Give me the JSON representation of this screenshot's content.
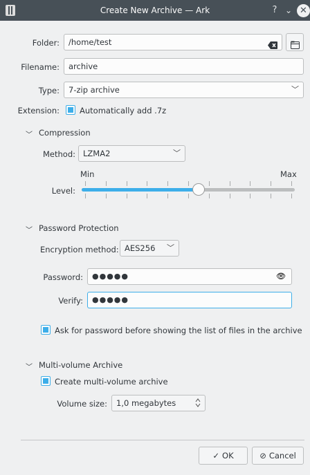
{
  "window": {
    "title": "Create New Archive — Ark",
    "help_glyph": "?",
    "minimize_glyph": "⌄",
    "close_glyph": "✕"
  },
  "folder": {
    "label": "Folder:",
    "value": "/home/test",
    "clear_icon": "backspace-clear-icon",
    "browse_icon": "folder-open-icon"
  },
  "filename": {
    "label": "Filename:",
    "value": "archive"
  },
  "type": {
    "label": "Type:",
    "selected": "7-zip archive"
  },
  "extension": {
    "label": "Extension:",
    "checkbox_label": "Automatically add .7z",
    "checked": true
  },
  "compression": {
    "section_label": "Compression",
    "method_label": "Method:",
    "method_selected": "LZMA2",
    "level_label": "Level:",
    "min_label": "Min",
    "max_label": "Max",
    "level_value": 0.55
  },
  "password_protection": {
    "section_label": "Password Protection",
    "encryption_label": "Encryption method:",
    "encryption_selected": "AES256",
    "password_label": "Password:",
    "password_value": "●●●●●",
    "verify_label": "Verify:",
    "verify_value": "●●●●●",
    "ask_label": "Ask for password before showing the list of files in the archive",
    "ask_checked": true
  },
  "multivolume": {
    "section_label": "Multi-volume Archive",
    "create_label": "Create multi-volume archive",
    "create_checked": true,
    "volume_size_label": "Volume size:",
    "volume_size_value": "1,0 megabytes"
  },
  "buttons": {
    "ok_label": "OK",
    "cancel_label": "Cancel"
  },
  "colors": {
    "accent": "#3daee9",
    "titlebar": "#475057",
    "background": "#eff0f1"
  }
}
